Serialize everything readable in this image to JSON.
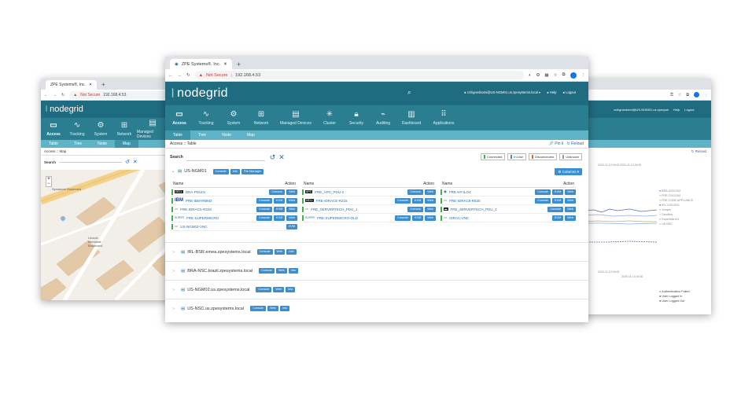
{
  "left_window": {
    "tab_title": "ZPE Systems®, Inc.",
    "not_secure": "Not Secure",
    "address": "192.168.4.53",
    "logo": "nodegrid",
    "modules": [
      {
        "label": "Access",
        "icon": "monitor-icon"
      },
      {
        "label": "Tracking",
        "icon": "pulse-icon"
      },
      {
        "label": "System",
        "icon": "gear-icon"
      },
      {
        "label": "Network",
        "icon": "network-icon"
      },
      {
        "label": "Managed Devices",
        "icon": "devices-icon"
      }
    ],
    "subtabs": [
      "Table",
      "Tree",
      "Node",
      "Map"
    ],
    "breadcrumb": "Access :: Map",
    "search_label": "Search",
    "map_labels": {
      "street": "Sycamore Boulevard",
      "place": "Lincoln Memorial Boulevard"
    }
  },
  "main_window": {
    "tab_title": "ZPE Systems®, Inc.",
    "not_secure": "Not Secure",
    "address": "192.168.4.53",
    "logo": "nodegrid",
    "user": "cchignesbomi@US-NGM01.us.zpesystems.local",
    "help": "Help",
    "logout": "Logout",
    "modules": [
      {
        "label": "Access",
        "icon": "monitor-icon"
      },
      {
        "label": "Tracking",
        "icon": "pulse-icon"
      },
      {
        "label": "System",
        "icon": "gear-icon"
      },
      {
        "label": "Network",
        "icon": "network-icon"
      },
      {
        "label": "Managed Devices",
        "icon": "devices-icon"
      },
      {
        "label": "Cluster",
        "icon": "cluster-icon"
      },
      {
        "label": "Security",
        "icon": "lock-icon"
      },
      {
        "label": "Auditing",
        "icon": "auditing-icon"
      },
      {
        "label": "Dashboard",
        "icon": "dashboard-icon"
      },
      {
        "label": "Applications",
        "icon": "grid-icon"
      }
    ],
    "subtabs": [
      "Table",
      "Tree",
      "Node",
      "Map"
    ],
    "breadcrumb": "Access :: Table",
    "pin_label": "Pin it",
    "reload_label": "Reload",
    "search_label": "Search",
    "legend": [
      {
        "label": "Connected",
        "color": "#3bb54a"
      },
      {
        "label": "In-Use",
        "color": "#3b8fd0"
      },
      {
        "label": "Disconnected",
        "color": "#e06a1b"
      },
      {
        "label": "Unknown",
        "color": "#999999"
      }
    ],
    "columns_button": "Columns",
    "site": {
      "name": "US-NGM01",
      "buttons": [
        "Console",
        "Info",
        "File Manager"
      ],
      "col_name": "Name",
      "col_action": "Action",
      "col1": [
        {
          "logo": "DELL",
          "name": "DRA-PDU01",
          "actions": [
            "Console",
            "Web"
          ]
        },
        {
          "logo": "IBM",
          "name": "PRE-IBM-RMM2",
          "actions": [
            "Console",
            "KVM",
            "Web"
          ]
        },
        {
          "logo": "",
          "name": "FRE-IDRACS-R240",
          "actions": [
            "Console",
            "KVM",
            "Web"
          ]
        },
        {
          "logo": "SUPER",
          "name": "FRE-SUPERMICRO",
          "actions": [
            "Console",
            "KVM",
            "Web"
          ]
        },
        {
          "logo": "",
          "name": "US-NGM03-VNC",
          "actions": [
            "KVM"
          ]
        }
      ],
      "col2": [
        {
          "logo": "APC",
          "name": "FRE_APC_PDU-3",
          "actions": [
            "Console",
            "Web"
          ]
        },
        {
          "logo": "DELL",
          "name": "FRE-IDRACE-R215",
          "actions": [
            "Console",
            "KVM",
            "Web"
          ]
        },
        {
          "logo": "",
          "name": "FRE_SERVERTECH_PDU_1",
          "actions": [
            "Console",
            "Web"
          ]
        },
        {
          "logo": "SUPER",
          "name": "FRE-SUPERMICRO-OLD",
          "actions": [
            "Console",
            "KVM",
            "Web"
          ]
        }
      ],
      "col3": [
        {
          "logo": "",
          "name": "FRE-NY-ILO4",
          "actions": [
            "Console",
            "KVM",
            "Web"
          ]
        },
        {
          "logo": "",
          "name": "FRE-IDRAC8-R530",
          "actions": [
            "Console",
            "KVM",
            "Web"
          ]
        },
        {
          "logo": "",
          "name": "FRE_SERVERTECH_PDU_2",
          "actions": [
            "Console",
            "Web"
          ]
        },
        {
          "logo": "",
          "name": "IDRAC-VNC",
          "actions": [
            "KVM",
            "Web"
          ]
        }
      ]
    },
    "other_sites": [
      {
        "name": "IRL-BSR.emea.zpesystems.local",
        "buttons": [
          "Console",
          "Web",
          "Info"
        ]
      },
      {
        "name": "BRA-NSC.brazil.zpesystems.local",
        "buttons": [
          "Console",
          "Web",
          "Info"
        ]
      },
      {
        "name": "US-NGM02.us.zpesystems.local",
        "buttons": [
          "Console",
          "Web",
          "Info"
        ]
      },
      {
        "name": "US-NSC.us.zpesystems.local",
        "buttons": [
          "Console",
          "Web",
          "Info"
        ]
      }
    ]
  },
  "right_window": {
    "user": "cchignesbomi@US-NGM01.us.zpesystems.local",
    "help": "Help",
    "logout": "Logout",
    "reload": "Reload",
    "times": [
      "2020-11-13 04:00",
      "2020-11-13 04:30"
    ],
    "series_legend": [
      {
        "label": "BRA-CISCO02",
        "color": "#5c6bc0"
      },
      {
        "label": "FRE-CISCO04",
        "color": "#9fa8da"
      },
      {
        "label": "FRE-CODE-APPLIANCE",
        "color": "#e6a04a"
      },
      {
        "label": "IRL-CISCO03",
        "color": "#444444"
      },
      {
        "label": "Juniper",
        "color": "#f0a060"
      },
      {
        "label": "Sandbox",
        "color": "#c0c0c0"
      },
      {
        "label": "SuperMicro01",
        "color": "#7fb3e0"
      },
      {
        "label": "US-NSC",
        "color": "#8fc6e8"
      }
    ],
    "events": [
      {
        "label": "Authentication Failed",
        "color": "#3bb54a"
      },
      {
        "label": "User Logged In",
        "color": "#444444"
      },
      {
        "label": "User Logged Out",
        "color": "#444444"
      }
    ]
  }
}
